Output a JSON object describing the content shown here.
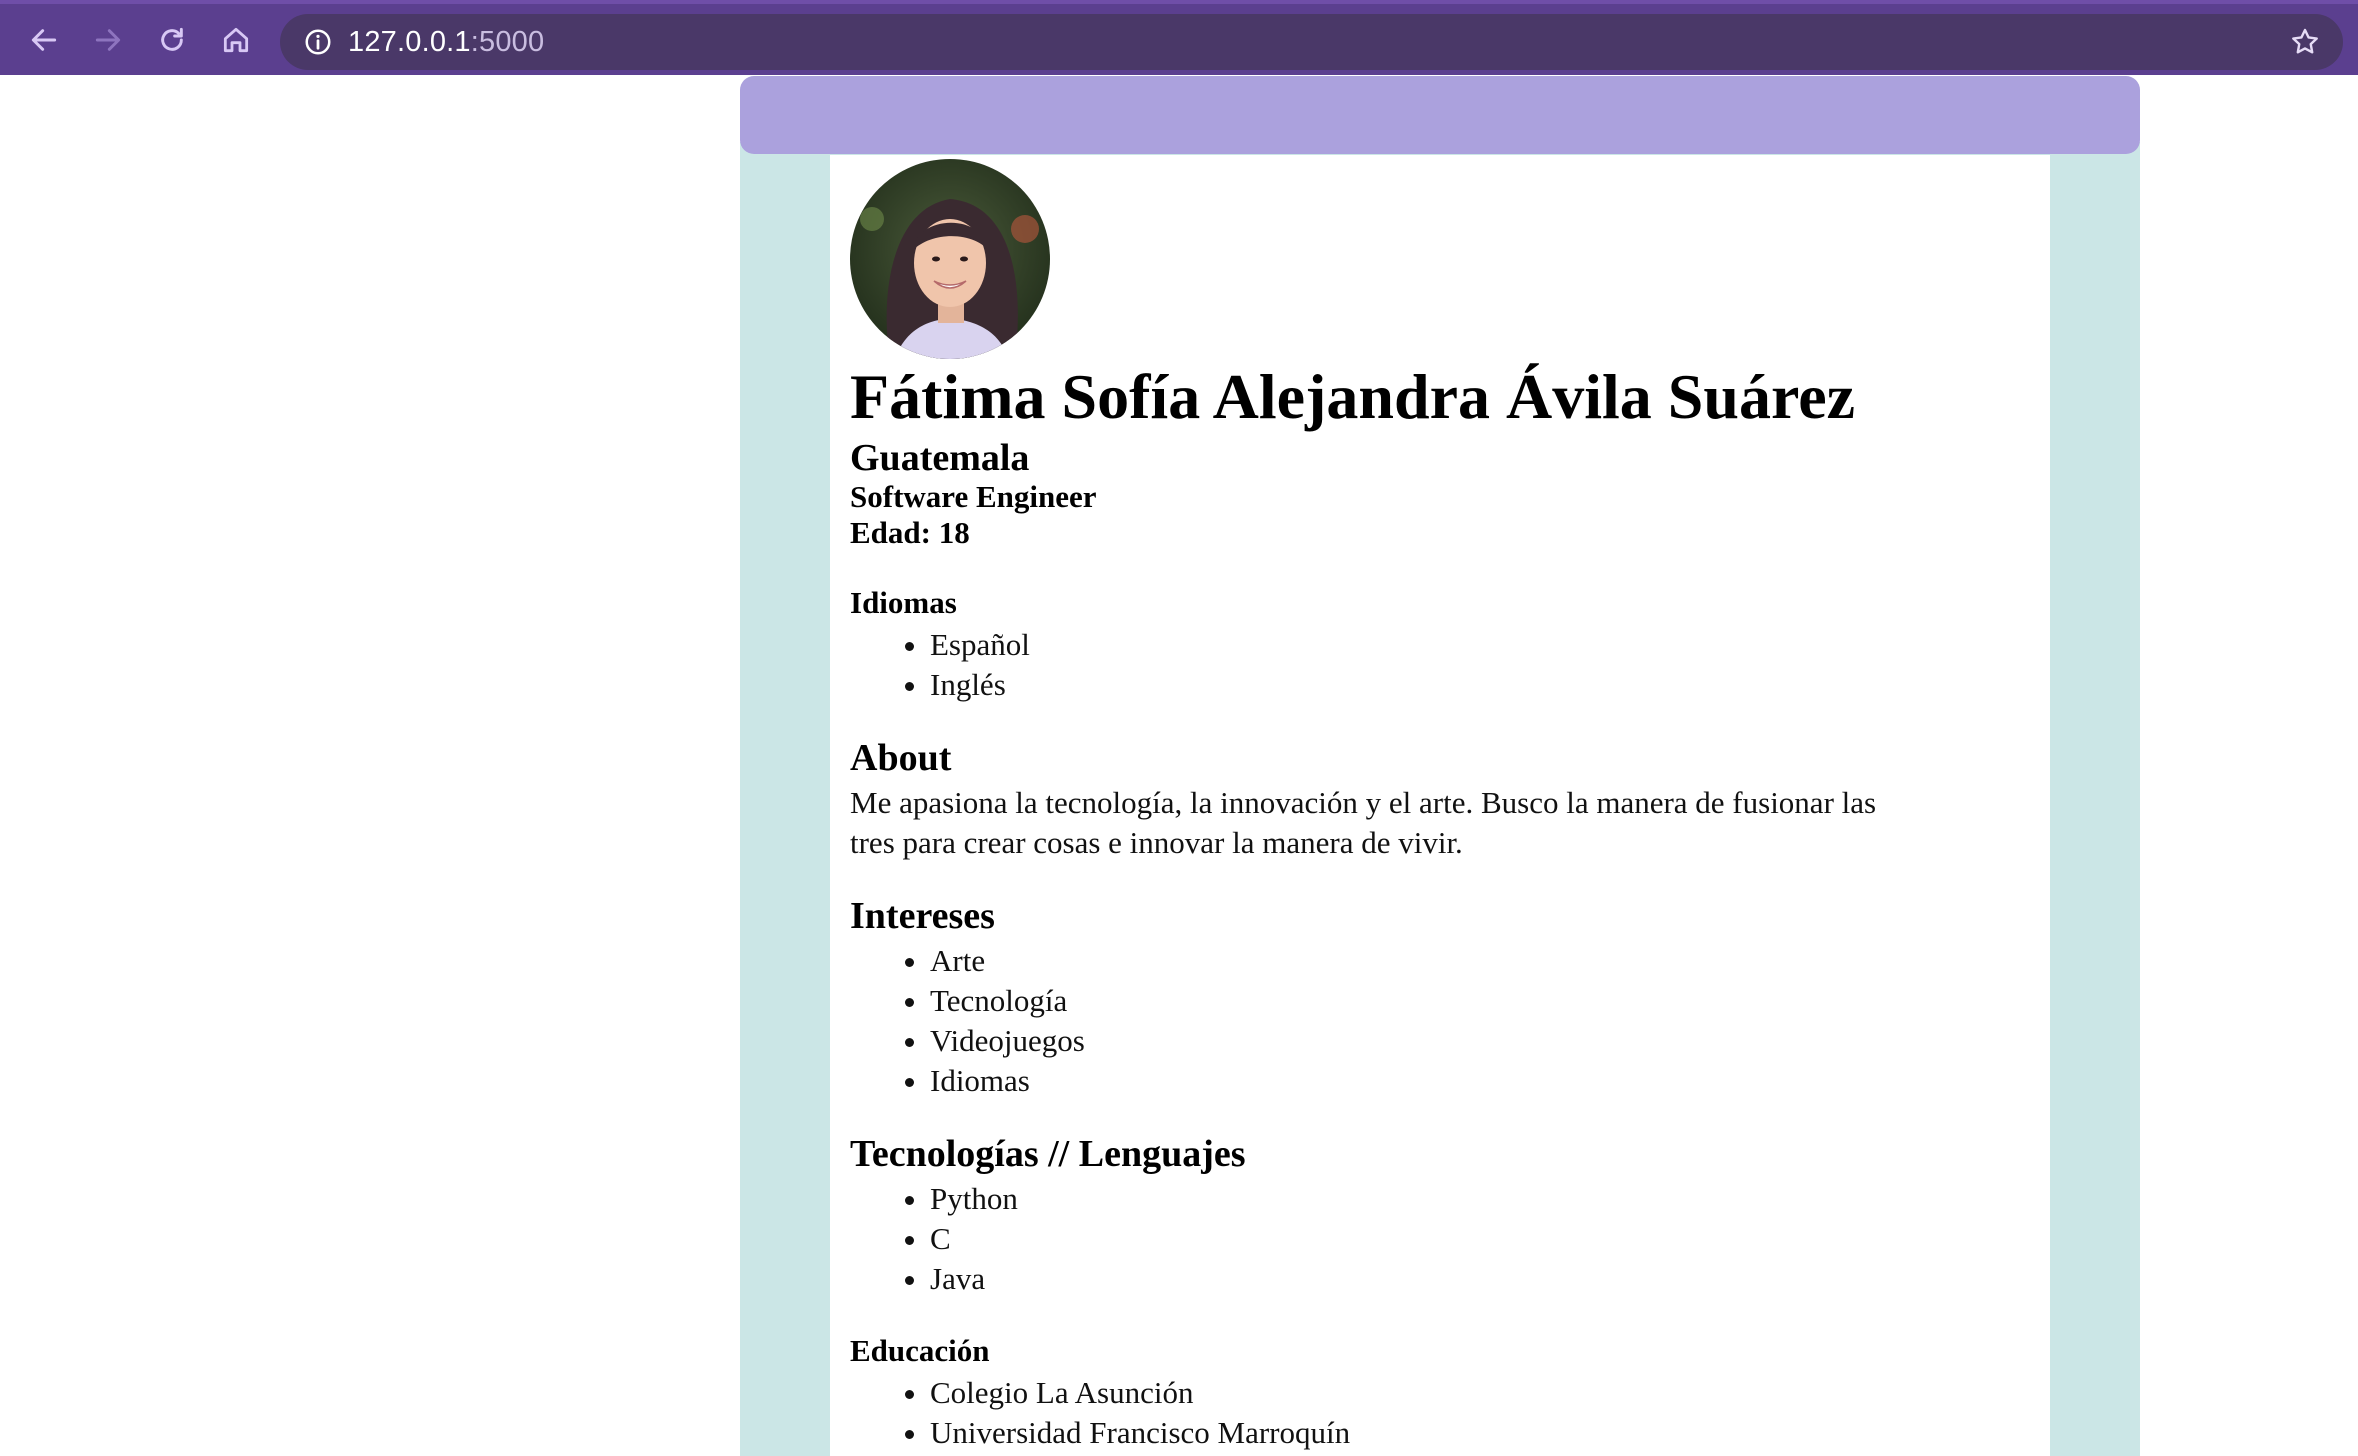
{
  "browser": {
    "url_host": "127.0.0.1",
    "url_port": ":5000",
    "icons": [
      "back-arrow-icon",
      "forward-arrow-icon",
      "reload-icon",
      "home-icon",
      "info-icon",
      "star-icon"
    ],
    "chrome_color": "#5b3f8f"
  },
  "colors": {
    "header": "#aba1dd",
    "frame": "#cbe6e6"
  },
  "profile": {
    "name": "Fátima Sofía Alejandra Ávila Suárez",
    "country": "Guatemala",
    "role": "Software Engineer",
    "age": "Edad: 18"
  },
  "languages": {
    "title": "Idiomas",
    "items": [
      "Español",
      "Inglés"
    ]
  },
  "about": {
    "title": "About",
    "text": "Me apasiona la tecnología, la innovación y el arte. Busco la manera de fusionar las tres para crear cosas e innovar la manera de vivir."
  },
  "interests": {
    "title": "Intereses",
    "items": [
      "Arte",
      "Tecnología",
      "Videojuegos",
      "Idiomas"
    ]
  },
  "tech": {
    "title": "Tecnologías // Lenguajes",
    "items": [
      "Python",
      "C",
      "Java"
    ]
  },
  "education": {
    "title": "Educación",
    "items": [
      "Colegio La Asunción",
      "Universidad Francisco Marroquín"
    ]
  }
}
